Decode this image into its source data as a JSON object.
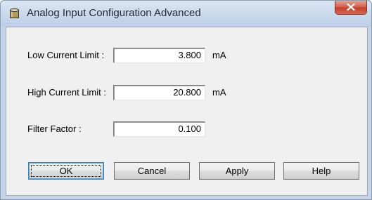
{
  "window": {
    "title": "Analog Input Configuration Advanced",
    "icon": "cylinder-icon",
    "close_icon": "close-x-icon"
  },
  "fields": {
    "low_current": {
      "label": "Low Current Limit :",
      "value": "3.800",
      "unit": "mA"
    },
    "high_current": {
      "label": "High Current Limit :",
      "value": "20.800",
      "unit": "mA"
    },
    "filter_factor": {
      "label": "Filter Factor :",
      "value": "0.100"
    }
  },
  "buttons": {
    "ok": "OK",
    "cancel": "Cancel",
    "apply": "Apply",
    "help": "Help"
  },
  "colors": {
    "titlebar": "#c9d8ec",
    "client_bg": "#f0f0f0",
    "close_button": "#c4402a",
    "default_button_border": "#3c7fb1"
  }
}
